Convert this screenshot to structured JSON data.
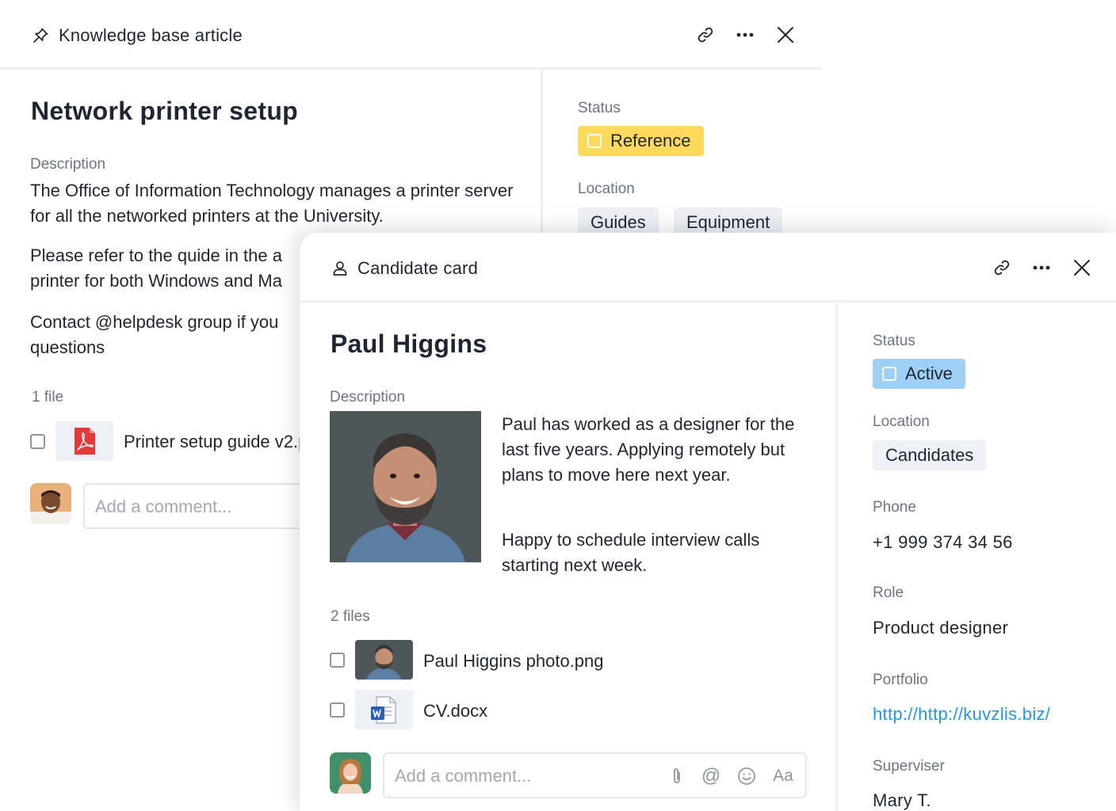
{
  "back_card": {
    "header": {
      "title": "Knowledge base article",
      "pin_icon": "pin-icon",
      "link_icon": "link-icon",
      "more_icon": "more-icon",
      "close_icon": "close-icon"
    },
    "title": "Network printer setup",
    "description_label": "Description",
    "paragraphs": [
      "The Office of Information Technology manages a printer server for all the networked printers at the University.",
      "Please refer to the quide in the a",
      "printer for both Windows and Ma",
      "Contact @helpdesk group if you",
      "questions"
    ],
    "files_label": "1 file",
    "files": [
      {
        "name": "Printer setup guide v2.p",
        "icon": "pdf-icon"
      }
    ],
    "comment_placeholder": "Add a comment...",
    "status_label": "Status",
    "status": "Reference",
    "location_label": "Location",
    "locations": [
      "Guides",
      "Equipment"
    ]
  },
  "front_card": {
    "header": {
      "title": "Candidate card",
      "person_icon": "person-icon",
      "link_icon": "link-icon",
      "more_icon": "more-icon",
      "close_icon": "close-icon"
    },
    "title": "Paul Higgins",
    "description_label": "Description",
    "paragraphs": [
      "Paul has worked as a designer for the last five years. Applying remotely but plans to move here next year.",
      "Happy to schedule interview calls starting next week."
    ],
    "files_label": "2 files",
    "files": [
      {
        "name": "Paul Higgins photo.png",
        "icon": "photo-thumbnail"
      },
      {
        "name": "CV.docx",
        "icon": "word-doc-icon"
      }
    ],
    "comment_placeholder": "Add a comment...",
    "comment_tools": [
      "paperclip-icon",
      "at-icon",
      "emoji-icon",
      "text-format-icon"
    ],
    "comment_format_label": "Aa",
    "comment_at_label": "@",
    "status_label": "Status",
    "status": "Active",
    "location_label": "Location",
    "locations": [
      "Candidates"
    ],
    "phone_label": "Phone",
    "phone": "+1 999 374 34 56",
    "role_label": "Role",
    "role": "Product designer",
    "portfolio_label": "Portfolio",
    "portfolio": "http://http://kuvzlis.biz/",
    "supervisor_label": "Superviser",
    "supervisor": "Mary T."
  },
  "colors": {
    "text": "#1f2633",
    "muted": "#6b7585",
    "status_reference": "#ffd95c",
    "status_active": "#9ed0f6",
    "chip_gray": "#edf0f4",
    "link": "#2496e8",
    "pdf_red": "#e03a3a",
    "word_blue": "#2b5fb8"
  }
}
